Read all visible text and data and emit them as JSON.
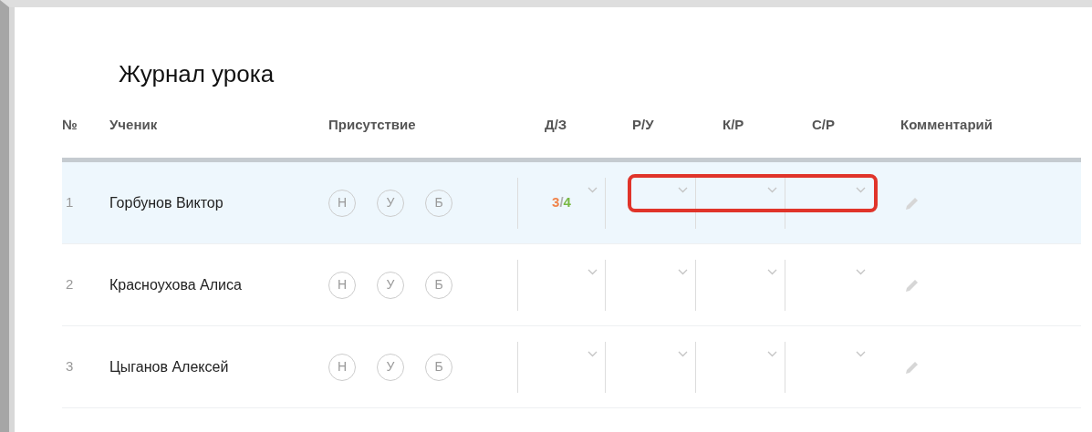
{
  "title": "Журнал урока",
  "columns": [
    "№",
    "Ученик",
    "Присутствие",
    "Д/З",
    "Р/У",
    "К/Р",
    "С/Р",
    "Комментарий"
  ],
  "rows": [
    {
      "number": "1",
      "student": "Горбунов Виктор",
      "selected": true,
      "framed": true,
      "attendance": [
        {
          "label": "Н",
          "selected": false
        },
        {
          "label": "У",
          "selected": false
        },
        {
          "label": "Б",
          "selected": false
        }
      ],
      "homework_mark": [
        {
          "text": "3",
          "color": "#f0834a"
        },
        {
          "text": "/",
          "color": "#b0b0b0"
        },
        {
          "text": "4",
          "color": "#78b843"
        }
      ]
    },
    {
      "number": "2",
      "student": "Красноухова Алиса",
      "selected": false,
      "framed": false,
      "attendance": [
        {
          "label": "Н",
          "selected": false
        },
        {
          "label": "У",
          "selected": false
        },
        {
          "label": "Б",
          "selected": false
        }
      ]
    },
    {
      "number": "3",
      "student": "Цыганов Алексей",
      "selected": false,
      "framed": false,
      "attendance": [
        {
          "label": "Н",
          "selected": false
        },
        {
          "label": "У",
          "selected": false
        },
        {
          "label": "Б",
          "selected": false
        }
      ]
    }
  ]
}
